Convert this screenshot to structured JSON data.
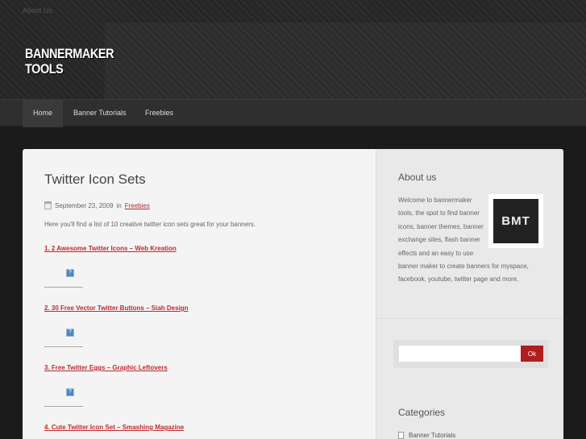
{
  "header": {
    "top_link": "About Us",
    "logo_line1": "BANNERMAKER",
    "logo_line2": "TOOLS"
  },
  "nav": [
    "Home",
    "Banner Tutorials",
    "Freebies"
  ],
  "post": {
    "title": "Twitter Icon Sets",
    "date": "September 23, 2009",
    "in": "in",
    "category": "Freebies",
    "intro": "Here you'll find a list of 10 creative twitter icon sets great for your banners.",
    "items": [
      "1. 2 Awesome Twitter Icons – Web Kreation",
      "2. 30 Free Vector Twitter Buttons – Siah Design",
      "3. Free Twitter Eggs – Graphic Leftovers",
      "4. Cute Twitter Icon Set – Smashing Magazine"
    ],
    "broken_image": "?"
  },
  "sidebar": {
    "about_title": "About us",
    "logo_text": "BMT",
    "about_text": "Welcome to bannermaker tools, the spot to find banner icons, banner themes, banner exchange sites, flash banner effects and an easy to use banner maker to create banners for myspace, facebook, youtube, twitter page and more.",
    "search_button": "Ok",
    "categories_title": "Categories",
    "categories": [
      "Banner Tutorials"
    ]
  }
}
